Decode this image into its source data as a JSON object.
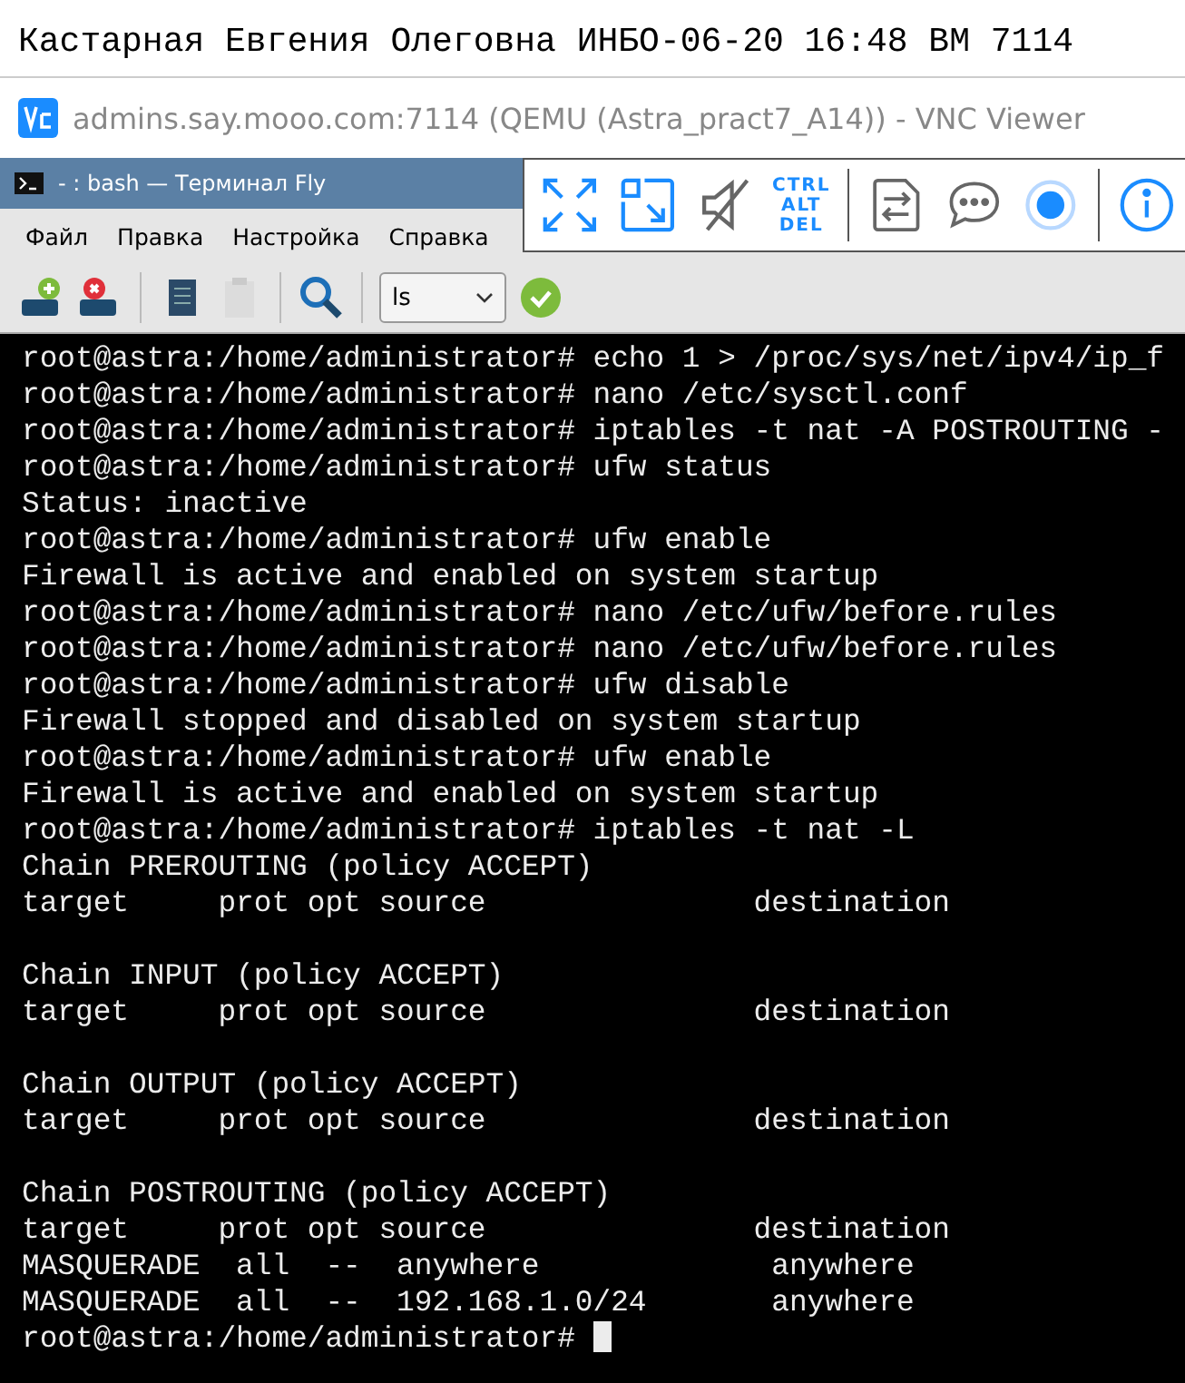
{
  "banner": {
    "text": "Кастарная Евгения Олеговна ИНБО-06-20 16:48 ВМ 7114"
  },
  "viewer": {
    "title": "admins.say.mooo.com:7114 (QEMU (Astra_pract7_A14)) - VNC Viewer",
    "toolbar": {
      "ctrl_alt_del": [
        "CTRL",
        "ALT",
        "DEL"
      ]
    }
  },
  "terminal_window": {
    "title": "- : bash — Терминал Fly",
    "menu": [
      "Файл",
      "Правка",
      "Настройка",
      "Справка"
    ],
    "toolbar": {
      "command_combo": "ls",
      "items": [
        {
          "kind": "new-tab",
          "disabled": false
        },
        {
          "kind": "close-tab",
          "disabled": false
        },
        {
          "kind": "copy",
          "disabled": false
        },
        {
          "kind": "paste",
          "disabled": true
        },
        {
          "kind": "find",
          "disabled": false
        }
      ]
    },
    "blocks": [
      [
        "root@astra:/home/administrator# echo 1 > /proc/sys/net/ipv4/ip_f",
        "root@astra:/home/administrator# nano /etc/sysctl.conf",
        "root@astra:/home/administrator# iptables -t nat -A POSTROUTING -",
        "root@astra:/home/administrator# ufw status",
        "Status: inactive",
        "root@astra:/home/administrator# ufw enable",
        "Firewall is active and enabled on system startup",
        "root@astra:/home/administrator# nano /etc/ufw/before.rules",
        "root@astra:/home/administrator# nano /etc/ufw/before.rules",
        "root@astra:/home/administrator# ufw disable",
        "Firewall stopped and disabled on system startup",
        "root@astra:/home/administrator# ufw enable",
        "Firewall is active and enabled on system startup",
        "root@astra:/home/administrator# iptables -t nat -L",
        "Chain PREROUTING (policy ACCEPT)",
        "target     prot opt source               destination"
      ],
      [
        "Chain INPUT (policy ACCEPT)",
        "target     prot opt source               destination"
      ],
      [
        "Chain OUTPUT (policy ACCEPT)",
        "target     prot opt source               destination"
      ],
      [
        "Chain POSTROUTING (policy ACCEPT)",
        "target     prot opt source               destination",
        "MASQUERADE  all  --  anywhere             anywhere",
        "MASQUERADE  all  --  192.168.1.0/24       anywhere"
      ]
    ],
    "prompt": "root@astra:/home/administrator# "
  }
}
